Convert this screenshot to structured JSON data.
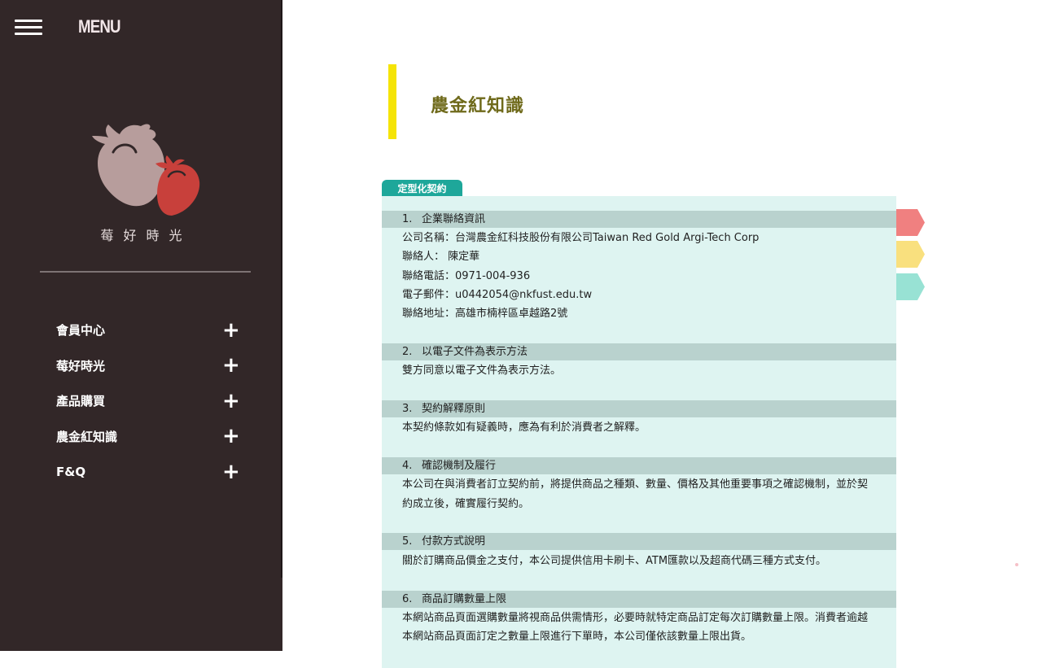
{
  "sidebar": {
    "menu_label": "MENU",
    "brand": "莓好時光",
    "items": [
      {
        "label": "會員中心",
        "plus": "+"
      },
      {
        "label": "莓好時光",
        "plus": "+"
      },
      {
        "label": "產品購買",
        "plus": "+"
      },
      {
        "label": "農金紅知識",
        "plus": "+"
      },
      {
        "label": "F&Q",
        "plus": "+"
      }
    ]
  },
  "main": {
    "title": "農金紅知識",
    "tab_label": "定型化契約",
    "sections": [
      {
        "num": "1.",
        "title": "企業聯絡資訊",
        "lines": [
          "公司名稱：台灣農金紅科技股份有限公司Taiwan Red Gold Argi-Tech Corp",
          "聯絡人： 陳定華",
          "聯絡電話：0971-004-936",
          "電子郵件：u0442054@nkfust.edu.tw",
          "聯絡地址：高雄市楠梓區卓越路2號"
        ]
      },
      {
        "num": "2.",
        "title": "以電子文件為表示方法",
        "lines": [
          "雙方同意以電子文件為表示方法。"
        ]
      },
      {
        "num": "3.",
        "title": "契約解釋原則",
        "lines": [
          "本契約條款如有疑義時，應為有利於消費者之解釋。"
        ]
      },
      {
        "num": "4.",
        "title": "確認機制及履行",
        "lines": [
          "本公司在與消費者訂立契約前，將提供商品之種類、數量、價格及其他重要事項之確認機制，並於契",
          "約成立後，確實履行契約。"
        ]
      },
      {
        "num": "5.",
        "title": "付款方式說明",
        "lines": [
          "關於訂購商品價金之支付，本公司提供信用卡刷卡、ATM匯款以及超商代碼三種方式支付。"
        ]
      },
      {
        "num": "6.",
        "title": "商品訂購數量上限",
        "lines": [
          "本網站商品頁面選購數量將視商品供需情形，必要時就特定商品訂定每次訂購數量上限。消費者逾越",
          "本網站商品頁面訂定之數量上限進行下單時，本公司僅依該數量上限出貨。"
        ]
      }
    ]
  },
  "colors": {
    "sidebar_bg": "#322728",
    "accent_yellow": "#f5e406",
    "tab_teal": "#1ea79a",
    "panel_bg": "#def4f1",
    "section_head_bg": "#b9d2ce",
    "flag_red": "#f08080",
    "flag_yellow": "#f9e07e",
    "flag_teal": "#98e2d4"
  }
}
